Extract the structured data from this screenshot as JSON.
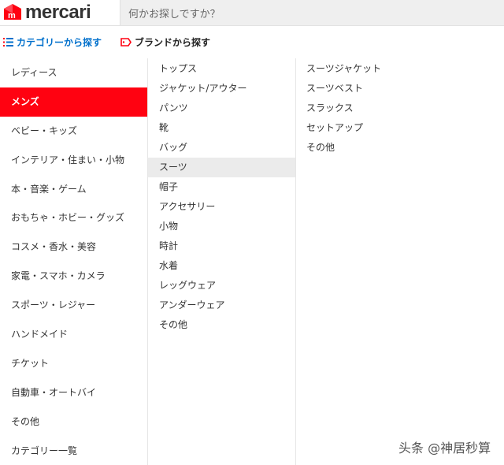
{
  "header": {
    "logo_text": "mercari",
    "search_placeholder": "何かお探しですか？"
  },
  "subnav": {
    "category_label": "カテゴリーから探す",
    "brand_label": "ブランドから探す"
  },
  "categories": [
    {
      "label": "レディース"
    },
    {
      "label": "メンズ",
      "active": true
    },
    {
      "label": "ベビー・キッズ"
    },
    {
      "label": "インテリア・住まい・小物"
    },
    {
      "label": "本・音楽・ゲーム"
    },
    {
      "label": "おもちゃ・ホビー・グッズ"
    },
    {
      "label": "コスメ・香水・美容"
    },
    {
      "label": "家電・スマホ・カメラ"
    },
    {
      "label": "スポーツ・レジャー"
    },
    {
      "label": "ハンドメイド"
    },
    {
      "label": "チケット"
    },
    {
      "label": "自動車・オートバイ"
    },
    {
      "label": "その他"
    },
    {
      "label": "カテゴリー一覧"
    }
  ],
  "subcategories": [
    {
      "label": "トップス"
    },
    {
      "label": "ジャケット/アウター"
    },
    {
      "label": "パンツ"
    },
    {
      "label": "靴"
    },
    {
      "label": "バッグ"
    },
    {
      "label": "スーツ",
      "active": true
    },
    {
      "label": "帽子"
    },
    {
      "label": "アクセサリー"
    },
    {
      "label": "小物"
    },
    {
      "label": "時計"
    },
    {
      "label": "水着"
    },
    {
      "label": "レッグウェア"
    },
    {
      "label": "アンダーウェア"
    },
    {
      "label": "その他"
    }
  ],
  "items": [
    {
      "label": "スーツジャケット"
    },
    {
      "label": "スーツベスト"
    },
    {
      "label": "スラックス"
    },
    {
      "label": "セットアップ"
    },
    {
      "label": "その他"
    }
  ],
  "watermark": "头条 @神居秒算",
  "colors": {
    "brand_red": "#ff0211",
    "link_blue": "#0070cc",
    "hover_gray": "#ebebeb"
  },
  "icons": {
    "logo": "mercari-m-icon",
    "category": "list-icon",
    "brand": "tag-icon"
  }
}
